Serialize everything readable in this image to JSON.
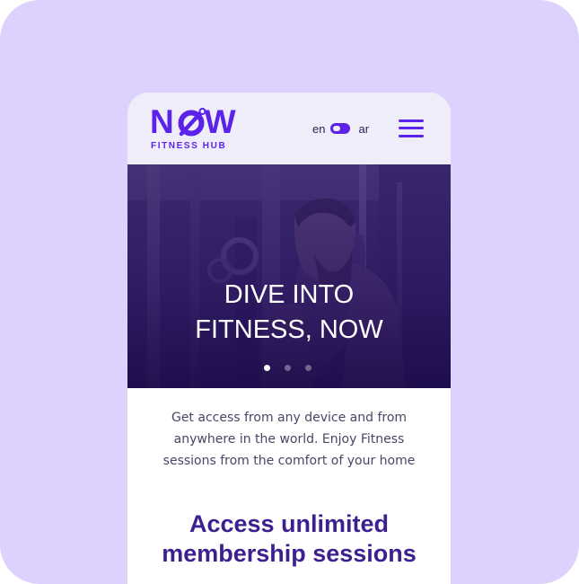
{
  "colors": {
    "backdrop": "#ddd2fd",
    "brand": "#5b23ea",
    "header_bg": "#f0edfb",
    "section_title": "#3d1f8f",
    "body_text": "#4a4566"
  },
  "header": {
    "logo": {
      "word": "NOW",
      "subtitle": "FITNESS HUB"
    },
    "language": {
      "left": "en",
      "right": "ar",
      "toggle_icon": "toggle-switch"
    },
    "menu_icon": "hamburger-menu"
  },
  "hero": {
    "title_line1": "DIVE INTO",
    "title_line2": "FITNESS, NOW",
    "slides_total": 3,
    "slide_active": 1
  },
  "intro": {
    "line1": "Get access from any device and from",
    "line2": "anywhere in the world. Enjoy Fitness",
    "line3": "sessions from the comfort of your home"
  },
  "section": {
    "title_line1": "Access unlimited",
    "title_line2": "membership sessions"
  }
}
